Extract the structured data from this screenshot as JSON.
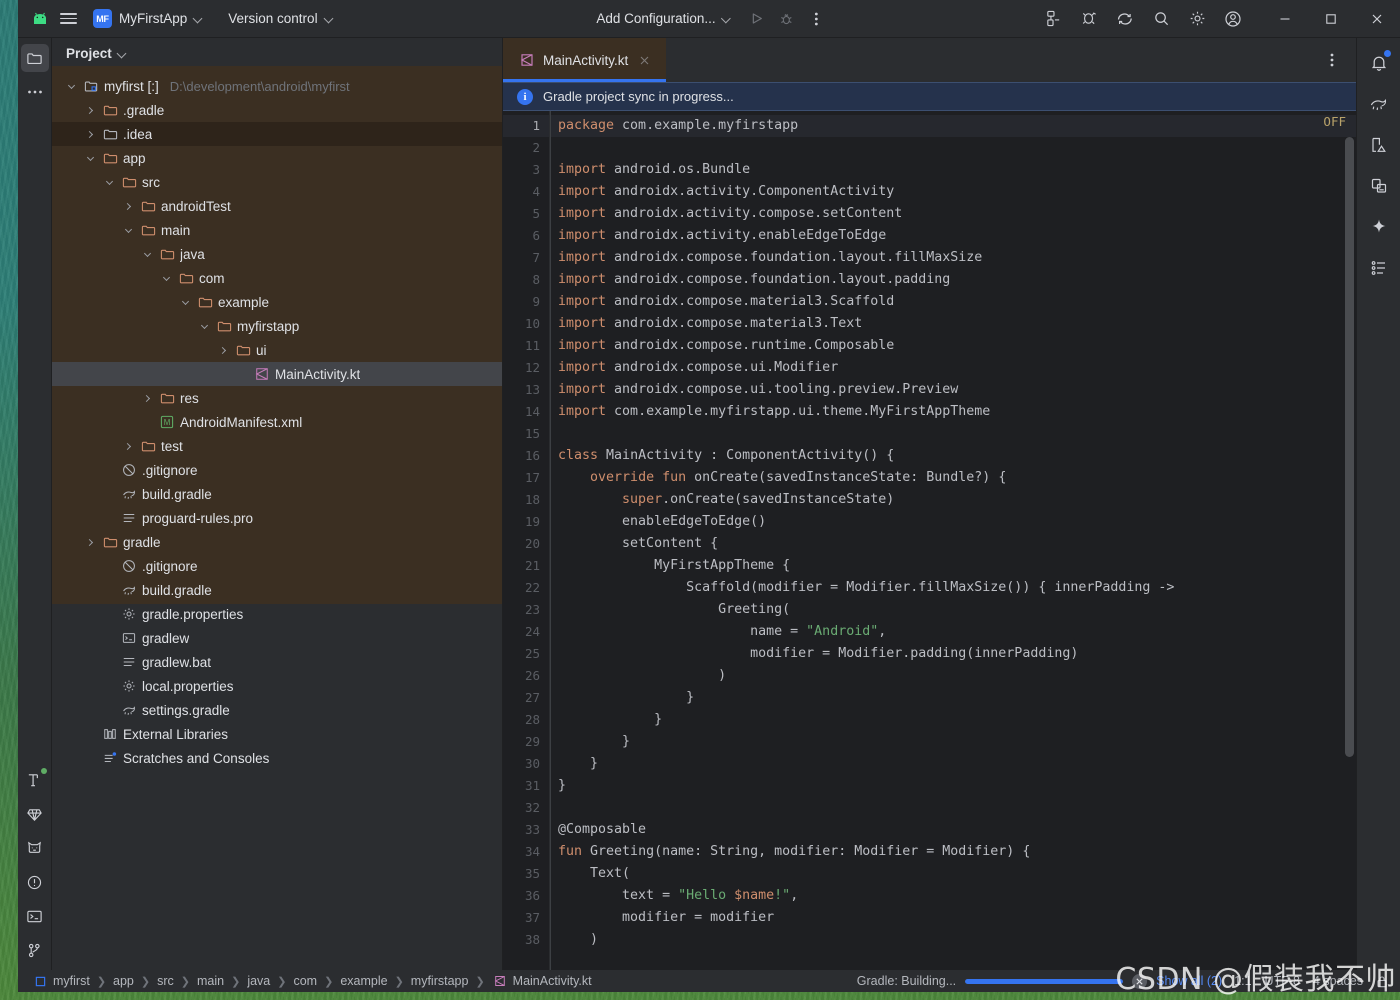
{
  "titlebar": {
    "app_logo": "android-logo",
    "menu_icon": "hamburger-menu-icon",
    "project_badge": "MF",
    "project_name": "MyFirstApp",
    "version_control": "Version control",
    "run_config": "Add Configuration...",
    "icons": {
      "run": "run-icon",
      "debug": "debug-icon",
      "more": "more-vertical-icon",
      "device_manager": "device-manager-icon",
      "running_devices": "running-devices-icon",
      "sync": "gradle-sync-icon",
      "search": "search-icon",
      "settings": "gear-icon",
      "account": "account-icon",
      "minimize": "minimize-icon",
      "maximize": "maximize-icon",
      "close": "close-icon"
    }
  },
  "left_rail": {
    "top": [
      {
        "name": "project-tool-window",
        "icon": "folder-icon",
        "active": true
      },
      {
        "name": "more-tool-windows",
        "icon": "more-horizontal-icon",
        "active": false
      }
    ],
    "bottom": [
      {
        "name": "build-tool-window",
        "icon": "hammer-icon",
        "badge": "green-dot"
      },
      {
        "name": "resource-manager-tool-window",
        "icon": "gem-icon",
        "badge": ""
      },
      {
        "name": "logcat-tool-window",
        "icon": "cat-icon",
        "badge": ""
      },
      {
        "name": "problems-tool-window",
        "icon": "warning-circle-icon",
        "badge": ""
      },
      {
        "name": "terminal-tool-window",
        "icon": "terminal-icon",
        "badge": ""
      },
      {
        "name": "version-control-tool-window",
        "icon": "branch-icon",
        "badge": ""
      }
    ]
  },
  "right_rail": [
    {
      "name": "notifications",
      "icon": "bell-icon",
      "badge": "blue-dot"
    },
    {
      "name": "gradle-tool-window",
      "icon": "elephant-icon",
      "badge": ""
    },
    {
      "name": "device-manager",
      "icon": "device-manager-icon",
      "badge": ""
    },
    {
      "name": "running-devices",
      "icon": "running-devices-icon",
      "badge": ""
    },
    {
      "name": "gemini",
      "icon": "sparkle-icon",
      "badge": ""
    },
    {
      "name": "structure",
      "icon": "structure-list-icon",
      "badge": ""
    }
  ],
  "project_panel": {
    "title": "Project",
    "tree": [
      {
        "depth": 0,
        "arrow": "open",
        "icon": "module-icon",
        "label": "myfirst [:]",
        "hint": "D:\\development\\android\\myfirst",
        "shaded": false,
        "selected": false
      },
      {
        "depth": 1,
        "arrow": "closed",
        "icon": "folder-orange",
        "label": ".gradle",
        "hint": "",
        "shaded": false,
        "selected": false
      },
      {
        "depth": 1,
        "arrow": "closed",
        "icon": "folder-grey",
        "label": ".idea",
        "hint": "",
        "shaded": true,
        "selected": false
      },
      {
        "depth": 1,
        "arrow": "open",
        "icon": "folder-orange",
        "label": "app",
        "hint": "",
        "shaded": false,
        "selected": false
      },
      {
        "depth": 2,
        "arrow": "open",
        "icon": "folder-orange",
        "label": "src",
        "hint": "",
        "shaded": false,
        "selected": false
      },
      {
        "depth": 3,
        "arrow": "closed",
        "icon": "folder-orange",
        "label": "androidTest",
        "hint": "",
        "shaded": false,
        "selected": false
      },
      {
        "depth": 3,
        "arrow": "open",
        "icon": "folder-orange",
        "label": "main",
        "hint": "",
        "shaded": false,
        "selected": false
      },
      {
        "depth": 4,
        "arrow": "open",
        "icon": "folder-orange",
        "label": "java",
        "hint": "",
        "shaded": false,
        "selected": false
      },
      {
        "depth": 5,
        "arrow": "open",
        "icon": "folder-orange",
        "label": "com",
        "hint": "",
        "shaded": false,
        "selected": false
      },
      {
        "depth": 6,
        "arrow": "open",
        "icon": "folder-orange",
        "label": "example",
        "hint": "",
        "shaded": false,
        "selected": false
      },
      {
        "depth": 7,
        "arrow": "open",
        "icon": "folder-orange",
        "label": "myfirstapp",
        "hint": "",
        "shaded": false,
        "selected": false
      },
      {
        "depth": 8,
        "arrow": "closed",
        "icon": "folder-orange",
        "label": "ui",
        "hint": "",
        "shaded": false,
        "selected": false
      },
      {
        "depth": 9,
        "arrow": "none",
        "icon": "kotlin-icon",
        "label": "MainActivity.kt",
        "hint": "",
        "shaded": false,
        "selected": true
      },
      {
        "depth": 4,
        "arrow": "closed",
        "icon": "folder-orange",
        "label": "res",
        "hint": "",
        "shaded": false,
        "selected": false
      },
      {
        "depth": 4,
        "arrow": "none",
        "icon": "manifest-icon",
        "label": "AndroidManifest.xml",
        "hint": "",
        "shaded": false,
        "selected": false
      },
      {
        "depth": 3,
        "arrow": "closed",
        "icon": "folder-orange",
        "label": "test",
        "hint": "",
        "shaded": false,
        "selected": false
      },
      {
        "depth": 2,
        "arrow": "none",
        "icon": "gitignore-icon",
        "label": ".gitignore",
        "hint": "",
        "shaded": false,
        "selected": false
      },
      {
        "depth": 2,
        "arrow": "none",
        "icon": "gradle-file-icon",
        "label": "build.gradle",
        "hint": "",
        "shaded": false,
        "selected": false
      },
      {
        "depth": 2,
        "arrow": "none",
        "icon": "text-file-icon",
        "label": "proguard-rules.pro",
        "hint": "",
        "shaded": false,
        "selected": false
      },
      {
        "depth": 1,
        "arrow": "closed",
        "icon": "folder-orange",
        "label": "gradle",
        "hint": "",
        "shaded": false,
        "selected": false
      },
      {
        "depth": 2,
        "arrow": "none",
        "icon": "gitignore-icon",
        "label": ".gitignore",
        "hint": "",
        "shaded": false,
        "selected": false
      },
      {
        "depth": 2,
        "arrow": "none",
        "icon": "gradle-file-icon",
        "label": "build.gradle",
        "hint": "",
        "shaded": false,
        "selected": false
      },
      {
        "depth": 2,
        "arrow": "none",
        "icon": "properties-icon",
        "label": "gradle.properties",
        "hint": "",
        "shaded": false,
        "selected": false
      },
      {
        "depth": 2,
        "arrow": "none",
        "icon": "shell-icon",
        "label": "gradlew",
        "hint": "",
        "shaded": false,
        "selected": false
      },
      {
        "depth": 2,
        "arrow": "none",
        "icon": "text-file-icon",
        "label": "gradlew.bat",
        "hint": "",
        "shaded": false,
        "selected": false
      },
      {
        "depth": 2,
        "arrow": "none",
        "icon": "properties-icon",
        "label": "local.properties",
        "hint": "",
        "shaded": false,
        "selected": false
      },
      {
        "depth": 2,
        "arrow": "none",
        "icon": "gradle-file-icon",
        "label": "settings.gradle",
        "hint": "",
        "shaded": false,
        "selected": false
      },
      {
        "depth": 1,
        "arrow": "none",
        "icon": "library-icon",
        "label": "External Libraries",
        "hint": "",
        "shaded": false,
        "selected": false
      },
      {
        "depth": 1,
        "arrow": "none",
        "icon": "scratches-icon",
        "label": "Scratches and Consoles",
        "hint": "",
        "shaded": false,
        "selected": false
      }
    ]
  },
  "editor": {
    "tab": {
      "label": "MainActivity.kt",
      "icon": "kotlin-icon",
      "close": "close-icon"
    },
    "sync_banner": "Gradle project sync in progress...",
    "inspection_widget": "OFF",
    "first_line": 1,
    "last_line": 38,
    "lines": [
      {
        "n": 1,
        "tokens": [
          {
            "t": "package ",
            "c": "kw"
          },
          {
            "t": "com.example.myfirstapp",
            "c": ""
          }
        ]
      },
      {
        "n": 2,
        "tokens": []
      },
      {
        "n": 3,
        "tokens": [
          {
            "t": "import ",
            "c": "kw"
          },
          {
            "t": "android.os.Bundle",
            "c": ""
          }
        ]
      },
      {
        "n": 4,
        "tokens": [
          {
            "t": "import ",
            "c": "kw"
          },
          {
            "t": "androidx.activity.ComponentActivity",
            "c": ""
          }
        ]
      },
      {
        "n": 5,
        "tokens": [
          {
            "t": "import ",
            "c": "kw"
          },
          {
            "t": "androidx.activity.compose.setContent",
            "c": ""
          }
        ]
      },
      {
        "n": 6,
        "tokens": [
          {
            "t": "import ",
            "c": "kw"
          },
          {
            "t": "androidx.activity.enableEdgeToEdge",
            "c": ""
          }
        ]
      },
      {
        "n": 7,
        "tokens": [
          {
            "t": "import ",
            "c": "kw"
          },
          {
            "t": "androidx.compose.foundation.layout.fillMaxSize",
            "c": ""
          }
        ]
      },
      {
        "n": 8,
        "tokens": [
          {
            "t": "import ",
            "c": "kw"
          },
          {
            "t": "androidx.compose.foundation.layout.padding",
            "c": ""
          }
        ]
      },
      {
        "n": 9,
        "tokens": [
          {
            "t": "import ",
            "c": "kw"
          },
          {
            "t": "androidx.compose.material3.Scaffold",
            "c": ""
          }
        ]
      },
      {
        "n": 10,
        "tokens": [
          {
            "t": "import ",
            "c": "kw"
          },
          {
            "t": "androidx.compose.material3.Text",
            "c": ""
          }
        ]
      },
      {
        "n": 11,
        "tokens": [
          {
            "t": "import ",
            "c": "kw"
          },
          {
            "t": "androidx.compose.runtime.Composable",
            "c": ""
          }
        ]
      },
      {
        "n": 12,
        "tokens": [
          {
            "t": "import ",
            "c": "kw"
          },
          {
            "t": "androidx.compose.ui.Modifier",
            "c": ""
          }
        ]
      },
      {
        "n": 13,
        "tokens": [
          {
            "t": "import ",
            "c": "kw"
          },
          {
            "t": "androidx.compose.ui.tooling.preview.Preview",
            "c": ""
          }
        ]
      },
      {
        "n": 14,
        "tokens": [
          {
            "t": "import ",
            "c": "kw"
          },
          {
            "t": "com.example.myfirstapp.ui.theme.MyFirstAppTheme",
            "c": ""
          }
        ]
      },
      {
        "n": 15,
        "tokens": []
      },
      {
        "n": 16,
        "tokens": [
          {
            "t": "class ",
            "c": "kw"
          },
          {
            "t": "MainActivity : ComponentActivity() {",
            "c": ""
          }
        ]
      },
      {
        "n": 17,
        "tokens": [
          {
            "t": "    ",
            "c": ""
          },
          {
            "t": "override fun ",
            "c": "kw"
          },
          {
            "t": "onCreate(savedInstanceState: Bundle?) {",
            "c": ""
          }
        ]
      },
      {
        "n": 18,
        "tokens": [
          {
            "t": "        ",
            "c": ""
          },
          {
            "t": "super",
            "c": "kw"
          },
          {
            "t": ".onCreate(savedInstanceState)",
            "c": ""
          }
        ]
      },
      {
        "n": 19,
        "tokens": [
          {
            "t": "        enableEdgeToEdge()",
            "c": ""
          }
        ]
      },
      {
        "n": 20,
        "tokens": [
          {
            "t": "        setContent {",
            "c": ""
          }
        ]
      },
      {
        "n": 21,
        "tokens": [
          {
            "t": "            MyFirstAppTheme {",
            "c": ""
          }
        ]
      },
      {
        "n": 22,
        "tokens": [
          {
            "t": "                Scaffold(modifier = Modifier.fillMaxSize()) { innerPadding ->",
            "c": ""
          }
        ]
      },
      {
        "n": 23,
        "tokens": [
          {
            "t": "                    Greeting(",
            "c": ""
          }
        ]
      },
      {
        "n": 24,
        "tokens": [
          {
            "t": "                        name = ",
            "c": ""
          },
          {
            "t": "\"Android\"",
            "c": "str"
          },
          {
            "t": ",",
            "c": ""
          }
        ]
      },
      {
        "n": 25,
        "tokens": [
          {
            "t": "                        modifier = Modifier.padding(innerPadding)",
            "c": ""
          }
        ]
      },
      {
        "n": 26,
        "tokens": [
          {
            "t": "                    )",
            "c": ""
          }
        ]
      },
      {
        "n": 27,
        "tokens": [
          {
            "t": "                }",
            "c": ""
          }
        ]
      },
      {
        "n": 28,
        "tokens": [
          {
            "t": "            }",
            "c": ""
          }
        ]
      },
      {
        "n": 29,
        "tokens": [
          {
            "t": "        }",
            "c": ""
          }
        ]
      },
      {
        "n": 30,
        "tokens": [
          {
            "t": "    }",
            "c": ""
          }
        ]
      },
      {
        "n": 31,
        "tokens": [
          {
            "t": "}",
            "c": ""
          }
        ]
      },
      {
        "n": 32,
        "tokens": []
      },
      {
        "n": 33,
        "tokens": [
          {
            "t": "@Composable",
            "c": "anno"
          }
        ]
      },
      {
        "n": 34,
        "tokens": [
          {
            "t": "fun ",
            "c": "kw"
          },
          {
            "t": "Greeting(name: String, modifier: Modifier = Modifier) {",
            "c": ""
          }
        ]
      },
      {
        "n": 35,
        "tokens": [
          {
            "t": "    Text(",
            "c": ""
          }
        ]
      },
      {
        "n": 36,
        "tokens": [
          {
            "t": "        text = ",
            "c": ""
          },
          {
            "t": "\"Hello ",
            "c": "str"
          },
          {
            "t": "$name",
            "c": "tmpl"
          },
          {
            "t": "!\"",
            "c": "str"
          },
          {
            "t": ",",
            "c": ""
          }
        ]
      },
      {
        "n": 37,
        "tokens": [
          {
            "t": "        modifier = modifier",
            "c": ""
          }
        ]
      },
      {
        "n": 38,
        "tokens": [
          {
            "t": "    )",
            "c": ""
          }
        ]
      }
    ]
  },
  "statusbar": {
    "breadcrumbs": [
      {
        "label": "myfirst",
        "icon": "module-icon"
      },
      {
        "label": "app",
        "icon": ""
      },
      {
        "label": "src",
        "icon": ""
      },
      {
        "label": "main",
        "icon": ""
      },
      {
        "label": "java",
        "icon": ""
      },
      {
        "label": "com",
        "icon": ""
      },
      {
        "label": "example",
        "icon": ""
      },
      {
        "label": "myfirstapp",
        "icon": ""
      },
      {
        "label": "MainActivity.kt",
        "icon": "kotlin-icon"
      }
    ],
    "gradle_status": "Gradle: Building...",
    "progress_percent": 100,
    "cancel_icon": "close-circle-icon",
    "show_all": "Show all (2)",
    "caret_position": "1:1",
    "encoding": "UTF-8",
    "indent": "4 spaces",
    "lock_icon": "lock-icon"
  },
  "watermark": "CSDN @假装我不帅",
  "colors": {
    "accent_blue": "#3574f0",
    "toolbar_bg": "#2b2d30",
    "editor_bg": "#1e1f22",
    "keyword_orange": "#cf8e6d",
    "string_green": "#6aab73",
    "sync_banner_bg": "#25324c",
    "tree_tint_brown": "#3b2f22",
    "selected_row": "#43454a"
  }
}
